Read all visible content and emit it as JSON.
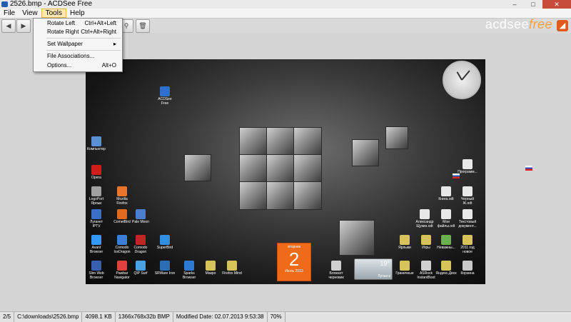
{
  "window": {
    "title": "2526.bmp - ACDSee Free",
    "minimize": "–",
    "maximize": "□",
    "close": "✕"
  },
  "menu": [
    {
      "label": "File"
    },
    {
      "label": "View"
    },
    {
      "label": "Tools"
    },
    {
      "label": "Help"
    }
  ],
  "toolbar": {
    "back_icon": "◀",
    "forward_icon": "▶",
    "zoom_icon": "⚲",
    "delete_icon": "🗑"
  },
  "logo": {
    "brand": "acdsee",
    "edition": "free",
    "icon_glyph": "◢"
  },
  "tools_menu": {
    "items": [
      {
        "label": "Rotate Left",
        "shortcut": "Ctrl+Alt+Left"
      },
      {
        "label": "Rotate Right",
        "shortcut": "Ctrl+Alt+Right"
      },
      {
        "label": "Set Wallpaper",
        "shortcut": "▸"
      },
      {
        "label": "File Associations...",
        "shortcut": ""
      },
      {
        "label": "Options...",
        "shortcut": "Alt+O"
      }
    ]
  },
  "image": {
    "desktop_icons": [
      {
        "label": "ACDSee Free",
        "color": "#2f6fd0"
      },
      {
        "label": "Компьютер",
        "color": "#5b8fd6"
      },
      {
        "label": "Opera",
        "color": "#d21b1b"
      },
      {
        "label": "LogoPort Ярлык",
        "color": "#a0a0a0"
      },
      {
        "label": "Mozilla Firefox",
        "color": "#e8752b"
      },
      {
        "label": "Луганет IPTV",
        "color": "#3b6ec9"
      },
      {
        "label": "CometBird",
        "color": "#e06b1f"
      },
      {
        "label": "Pale Moon",
        "color": "#4a7fd0"
      },
      {
        "label": "Avant Browser",
        "color": "#3399ff"
      },
      {
        "label": "Comodo IceDragon",
        "color": "#3c7dd8"
      },
      {
        "label": "Comodo Dragon",
        "color": "#c02525"
      },
      {
        "label": "SuperBird",
        "color": "#2f8fe0"
      },
      {
        "label": "Slim Web Browser",
        "color": "#3a5fb0"
      },
      {
        "label": "Pawbar Navigator",
        "color": "#e04040"
      },
      {
        "label": "QIP Surf",
        "color": "#4aa3e0"
      },
      {
        "label": "SRWare Iron",
        "color": "#2a6fb5"
      },
      {
        "label": "Sparks Browser",
        "color": "#2f7ad0"
      },
      {
        "label": "Макро",
        "color": "#d8c25a"
      },
      {
        "label": "Firefox Mind",
        "color": "#d8c25a"
      },
      {
        "label": "Блокнот черновик",
        "color": "#cfcfcf"
      },
      {
        "label": "Ярлыки",
        "color": "#d8c25a"
      },
      {
        "label": "Игры",
        "color": "#d8c25a"
      },
      {
        "label": "Неважны...",
        "color": "#6ab04c"
      },
      {
        "label": "2011 год новое",
        "color": "#d8c25a"
      },
      {
        "label": "Граничные",
        "color": "#d8c25a"
      },
      {
        "label": "ASRock InstantBoot",
        "color": "#d0d0d0"
      },
      {
        "label": "Яндекс.Диск",
        "color": "#d8c25a"
      },
      {
        "label": "Корзина",
        "color": "#c8c8c8"
      },
      {
        "label": "Александр Щукин.odt",
        "color": "#e8e8e8"
      },
      {
        "label": "Мои файлы.odt",
        "color": "#e8e8e8"
      },
      {
        "label": "Текстовый документ...",
        "color": "#e8e8e8"
      },
      {
        "label": "Книга.odt",
        "color": "#e8e8e8"
      },
      {
        "label": "Черный Ж.odt",
        "color": "#e8e8e8"
      },
      {
        "label": "Программ...",
        "color": "#e8e8e8"
      }
    ],
    "calendar": {
      "day_name": "вторник",
      "day": "2",
      "month_year": "Июль 2013"
    },
    "weather": {
      "temp": "19°",
      "city": "Луганск"
    }
  },
  "status": {
    "position": "2/5",
    "path": "C:\\downloads\\2526.bmp",
    "size": "4098.1 KB",
    "dims": "1366x768x32b BMP",
    "modified": "Modified Date: 02.07.2013 9:53:38",
    "zoom": "70%"
  }
}
